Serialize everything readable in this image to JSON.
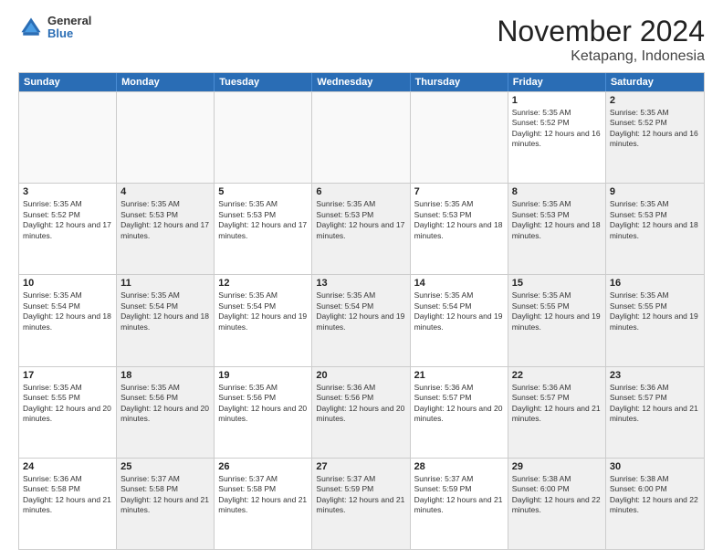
{
  "header": {
    "logo": {
      "line1": "General",
      "line2": "Blue"
    },
    "title": "November 2024",
    "location": "Ketapang, Indonesia"
  },
  "days_of_week": [
    "Sunday",
    "Monday",
    "Tuesday",
    "Wednesday",
    "Thursday",
    "Friday",
    "Saturday"
  ],
  "weeks": [
    [
      {
        "day": "",
        "empty": true
      },
      {
        "day": "",
        "empty": true
      },
      {
        "day": "",
        "empty": true
      },
      {
        "day": "",
        "empty": true
      },
      {
        "day": "",
        "empty": true
      },
      {
        "day": "1",
        "sunrise": "Sunrise: 5:35 AM",
        "sunset": "Sunset: 5:52 PM",
        "daylight": "Daylight: 12 hours and 16 minutes."
      },
      {
        "day": "2",
        "sunrise": "Sunrise: 5:35 AM",
        "sunset": "Sunset: 5:52 PM",
        "daylight": "Daylight: 12 hours and 16 minutes.",
        "shaded": true
      }
    ],
    [
      {
        "day": "3",
        "sunrise": "Sunrise: 5:35 AM",
        "sunset": "Sunset: 5:52 PM",
        "daylight": "Daylight: 12 hours and 17 minutes."
      },
      {
        "day": "4",
        "sunrise": "Sunrise: 5:35 AM",
        "sunset": "Sunset: 5:53 PM",
        "daylight": "Daylight: 12 hours and 17 minutes.",
        "shaded": true
      },
      {
        "day": "5",
        "sunrise": "Sunrise: 5:35 AM",
        "sunset": "Sunset: 5:53 PM",
        "daylight": "Daylight: 12 hours and 17 minutes."
      },
      {
        "day": "6",
        "sunrise": "Sunrise: 5:35 AM",
        "sunset": "Sunset: 5:53 PM",
        "daylight": "Daylight: 12 hours and 17 minutes.",
        "shaded": true
      },
      {
        "day": "7",
        "sunrise": "Sunrise: 5:35 AM",
        "sunset": "Sunset: 5:53 PM",
        "daylight": "Daylight: 12 hours and 18 minutes."
      },
      {
        "day": "8",
        "sunrise": "Sunrise: 5:35 AM",
        "sunset": "Sunset: 5:53 PM",
        "daylight": "Daylight: 12 hours and 18 minutes.",
        "shaded": true
      },
      {
        "day": "9",
        "sunrise": "Sunrise: 5:35 AM",
        "sunset": "Sunset: 5:53 PM",
        "daylight": "Daylight: 12 hours and 18 minutes.",
        "shaded": true
      }
    ],
    [
      {
        "day": "10",
        "sunrise": "Sunrise: 5:35 AM",
        "sunset": "Sunset: 5:54 PM",
        "daylight": "Daylight: 12 hours and 18 minutes."
      },
      {
        "day": "11",
        "sunrise": "Sunrise: 5:35 AM",
        "sunset": "Sunset: 5:54 PM",
        "daylight": "Daylight: 12 hours and 18 minutes.",
        "shaded": true
      },
      {
        "day": "12",
        "sunrise": "Sunrise: 5:35 AM",
        "sunset": "Sunset: 5:54 PM",
        "daylight": "Daylight: 12 hours and 19 minutes."
      },
      {
        "day": "13",
        "sunrise": "Sunrise: 5:35 AM",
        "sunset": "Sunset: 5:54 PM",
        "daylight": "Daylight: 12 hours and 19 minutes.",
        "shaded": true
      },
      {
        "day": "14",
        "sunrise": "Sunrise: 5:35 AM",
        "sunset": "Sunset: 5:54 PM",
        "daylight": "Daylight: 12 hours and 19 minutes."
      },
      {
        "day": "15",
        "sunrise": "Sunrise: 5:35 AM",
        "sunset": "Sunset: 5:55 PM",
        "daylight": "Daylight: 12 hours and 19 minutes.",
        "shaded": true
      },
      {
        "day": "16",
        "sunrise": "Sunrise: 5:35 AM",
        "sunset": "Sunset: 5:55 PM",
        "daylight": "Daylight: 12 hours and 19 minutes.",
        "shaded": true
      }
    ],
    [
      {
        "day": "17",
        "sunrise": "Sunrise: 5:35 AM",
        "sunset": "Sunset: 5:55 PM",
        "daylight": "Daylight: 12 hours and 20 minutes."
      },
      {
        "day": "18",
        "sunrise": "Sunrise: 5:35 AM",
        "sunset": "Sunset: 5:56 PM",
        "daylight": "Daylight: 12 hours and 20 minutes.",
        "shaded": true
      },
      {
        "day": "19",
        "sunrise": "Sunrise: 5:35 AM",
        "sunset": "Sunset: 5:56 PM",
        "daylight": "Daylight: 12 hours and 20 minutes."
      },
      {
        "day": "20",
        "sunrise": "Sunrise: 5:36 AM",
        "sunset": "Sunset: 5:56 PM",
        "daylight": "Daylight: 12 hours and 20 minutes.",
        "shaded": true
      },
      {
        "day": "21",
        "sunrise": "Sunrise: 5:36 AM",
        "sunset": "Sunset: 5:57 PM",
        "daylight": "Daylight: 12 hours and 20 minutes."
      },
      {
        "day": "22",
        "sunrise": "Sunrise: 5:36 AM",
        "sunset": "Sunset: 5:57 PM",
        "daylight": "Daylight: 12 hours and 21 minutes.",
        "shaded": true
      },
      {
        "day": "23",
        "sunrise": "Sunrise: 5:36 AM",
        "sunset": "Sunset: 5:57 PM",
        "daylight": "Daylight: 12 hours and 21 minutes.",
        "shaded": true
      }
    ],
    [
      {
        "day": "24",
        "sunrise": "Sunrise: 5:36 AM",
        "sunset": "Sunset: 5:58 PM",
        "daylight": "Daylight: 12 hours and 21 minutes."
      },
      {
        "day": "25",
        "sunrise": "Sunrise: 5:37 AM",
        "sunset": "Sunset: 5:58 PM",
        "daylight": "Daylight: 12 hours and 21 minutes.",
        "shaded": true
      },
      {
        "day": "26",
        "sunrise": "Sunrise: 5:37 AM",
        "sunset": "Sunset: 5:58 PM",
        "daylight": "Daylight: 12 hours and 21 minutes."
      },
      {
        "day": "27",
        "sunrise": "Sunrise: 5:37 AM",
        "sunset": "Sunset: 5:59 PM",
        "daylight": "Daylight: 12 hours and 21 minutes.",
        "shaded": true
      },
      {
        "day": "28",
        "sunrise": "Sunrise: 5:37 AM",
        "sunset": "Sunset: 5:59 PM",
        "daylight": "Daylight: 12 hours and 21 minutes."
      },
      {
        "day": "29",
        "sunrise": "Sunrise: 5:38 AM",
        "sunset": "Sunset: 6:00 PM",
        "daylight": "Daylight: 12 hours and 22 minutes.",
        "shaded": true
      },
      {
        "day": "30",
        "sunrise": "Sunrise: 5:38 AM",
        "sunset": "Sunset: 6:00 PM",
        "daylight": "Daylight: 12 hours and 22 minutes.",
        "shaded": true
      }
    ]
  ]
}
